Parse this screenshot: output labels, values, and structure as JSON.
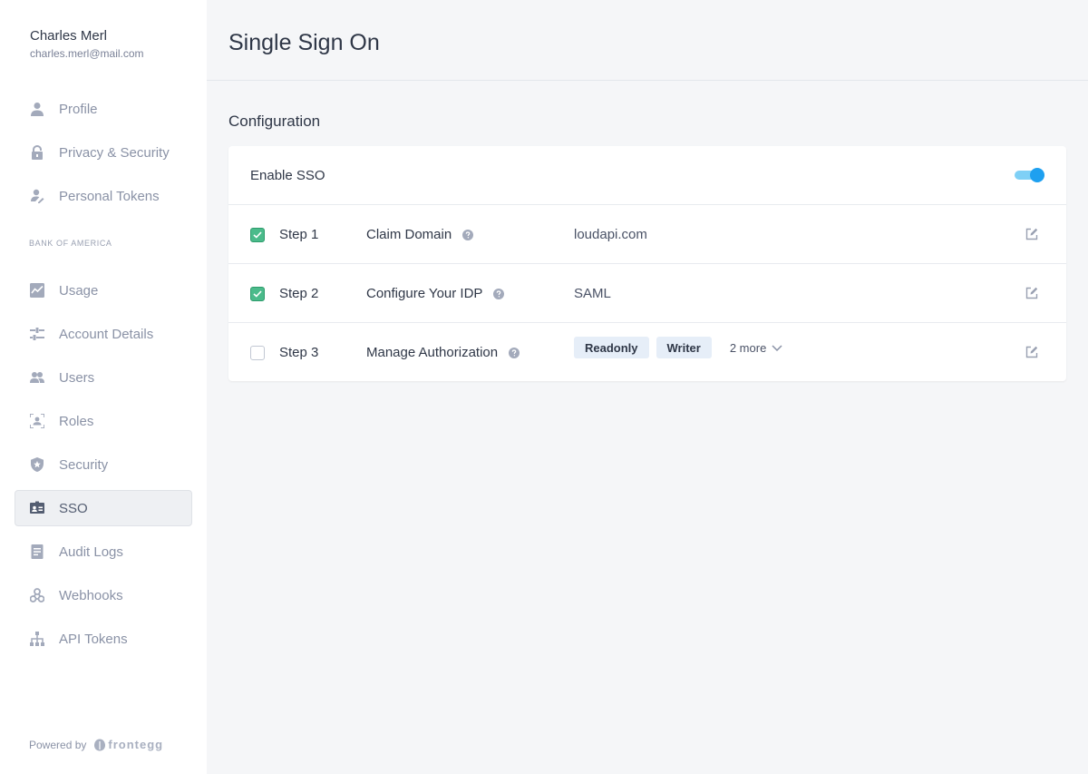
{
  "user": {
    "name": "Charles Merl",
    "email": "charles.merl@mail.com"
  },
  "sidebar": {
    "personal_items": [
      {
        "label": "Profile",
        "icon": "user-icon"
      },
      {
        "label": "Privacy & Security",
        "icon": "lock-icon"
      },
      {
        "label": "Personal Tokens",
        "icon": "user-key-icon"
      }
    ],
    "section_label": "BANK OF AMERICA",
    "account_items": [
      {
        "label": "Usage",
        "icon": "chart-icon"
      },
      {
        "label": "Account Details",
        "icon": "sliders-icon"
      },
      {
        "label": "Users",
        "icon": "users-icon"
      },
      {
        "label": "Roles",
        "icon": "roles-icon"
      },
      {
        "label": "Security",
        "icon": "shield-icon"
      },
      {
        "label": "SSO",
        "icon": "id-card-icon",
        "active": true
      },
      {
        "label": "Audit Logs",
        "icon": "document-icon"
      },
      {
        "label": "Webhooks",
        "icon": "webhook-icon"
      },
      {
        "label": "API Tokens",
        "icon": "hierarchy-icon"
      }
    ],
    "powered_by": "Powered by",
    "brand": "frontegg"
  },
  "page": {
    "title": "Single Sign On",
    "section_title": "Configuration"
  },
  "sso": {
    "enable_label": "Enable SSO",
    "enabled": true,
    "steps": [
      {
        "step": "Step 1",
        "title": "Claim Domain",
        "value": "loudapi.com",
        "checked": true
      },
      {
        "step": "Step 2",
        "title": "Configure Your IDP",
        "value": "SAML",
        "checked": true
      },
      {
        "step": "Step 3",
        "title": "Manage Authorization",
        "tags": [
          "Readonly",
          "Writer"
        ],
        "more": "2 more",
        "checked": false
      }
    ]
  },
  "colors": {
    "accent": "#1ea0f0",
    "check": "#4bbb8b",
    "tag_bg": "#e6eef8"
  }
}
